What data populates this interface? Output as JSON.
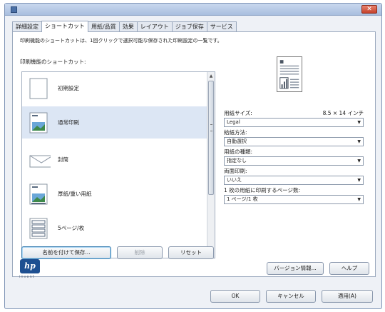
{
  "window": {
    "close_symbol": "✕",
    "app_icon": "printer-icon"
  },
  "tabs": [
    {
      "label": "詳細設定",
      "active": false
    },
    {
      "label": "ショートカット",
      "active": true
    },
    {
      "label": "用紙/品質",
      "active": false
    },
    {
      "label": "効果",
      "active": false
    },
    {
      "label": "レイアウト",
      "active": false
    },
    {
      "label": "ジョブ保存",
      "active": false
    },
    {
      "label": "サービス",
      "active": false
    }
  ],
  "description": "印刷機能のショートカットは、1回クリックで選択可能な保存された印刷設定の一覧です。",
  "list_heading": "印刷機能のショートカット:",
  "shortcuts": [
    {
      "label": "初期設定",
      "icon": "blank-page-icon"
    },
    {
      "label": "通常印刷",
      "icon": "photo-page-icon"
    },
    {
      "label": "封筒",
      "icon": "envelope-icon"
    },
    {
      "label": "厚紙/重い用紙",
      "icon": "heavy-paper-icon"
    },
    {
      "label": "5ページ/枚",
      "icon": "multi-page-icon"
    }
  ],
  "buttons": {
    "save_as": "名前を付けて保存...",
    "delete": "削除",
    "reset": "リセット",
    "about": "バージョン情報...",
    "help": "ヘルプ",
    "ok": "OK",
    "cancel": "キャンセル",
    "apply": "適用(A)"
  },
  "settings": {
    "paper_size_label": "用紙サイズ:",
    "paper_size_value": "8.5 × 14 インチ",
    "paper_size_combo": "Legal",
    "source_label": "給紙方法:",
    "source_combo": "自動選択",
    "type_label": "用紙の種類:",
    "type_combo": "指定なし",
    "duplex_label": "両面印刷:",
    "duplex_combo": "いいえ",
    "pages_per_sheet_label": "1 枚の用紙に印刷するページ数:",
    "pages_per_sheet_combo": "1 ページ/1 枚"
  },
  "logo": {
    "text": "hp",
    "subtext": "invent"
  }
}
